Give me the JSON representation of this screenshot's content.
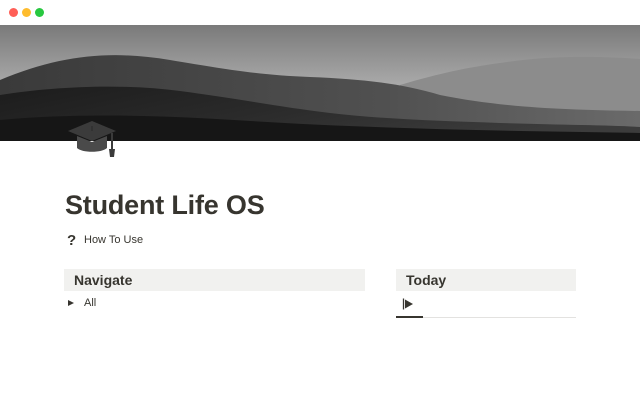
{
  "window": {
    "controls": [
      "close",
      "minimize",
      "maximize"
    ]
  },
  "cover": {
    "description": "grayscale desert dunes"
  },
  "page": {
    "icon": "graduation-cap-icon",
    "title": "Student Life OS"
  },
  "how_to": {
    "icon": "question-mark-icon",
    "glyph": "?",
    "label": "How To Use"
  },
  "navigate": {
    "title": "Navigate",
    "items": [
      {
        "label": "All",
        "icon": "toggle-arrow-icon",
        "expanded": false
      }
    ]
  },
  "today": {
    "title": "Today",
    "widget_icon": "play-flag-icon",
    "progress": 0.15
  },
  "colors": {
    "text": "#37352f",
    "header_bg": "#f1f1ef",
    "divider": "#e3e2e0",
    "close": "#ff5f57",
    "minimize": "#febc2e",
    "maximize": "#28c840"
  }
}
